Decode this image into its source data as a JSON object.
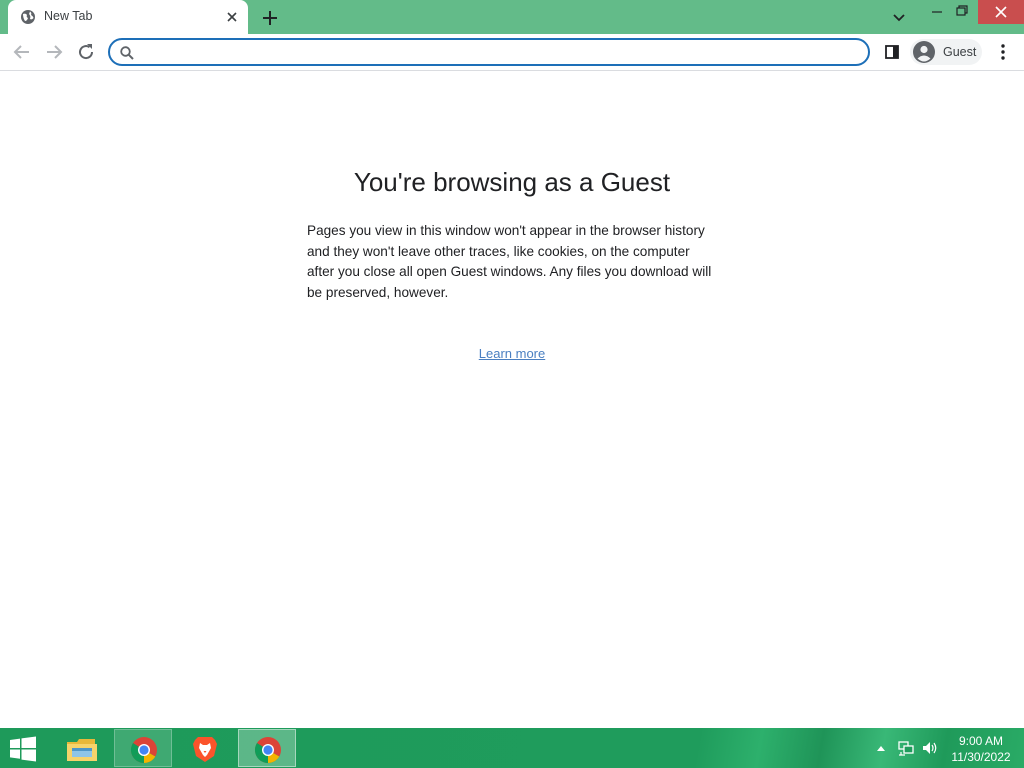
{
  "browser": {
    "tab": {
      "title": "New Tab",
      "favicon": "globe-icon"
    },
    "window_controls": [
      "tab-search-icon",
      "minimize-icon",
      "restore-icon",
      "close-icon"
    ],
    "toolbar": {
      "omnibox_value": "",
      "profile_label": "Guest"
    },
    "colors": {
      "frame": "#63bb89",
      "omnibox_border": "#1d6fb8",
      "close_button": "#c94e4e",
      "link": "#4a7fc1"
    }
  },
  "page": {
    "title": "You're browsing as a Guest",
    "body": "Pages you view in this window won't appear in the browser history and they won't leave other traces, like cookies, on the computer after you close all open Guest windows. Any files you download will be preserved, however.",
    "learn_more": "Learn more"
  },
  "taskbar": {
    "apps": [
      "file-explorer-icon",
      "chrome-icon",
      "brave-icon",
      "chrome-icon"
    ],
    "tray_icons": [
      "show-hidden-icons-icon",
      "network-icon",
      "volume-icon"
    ],
    "clock": {
      "time": "9:00 AM",
      "date": "11/30/2022"
    }
  }
}
